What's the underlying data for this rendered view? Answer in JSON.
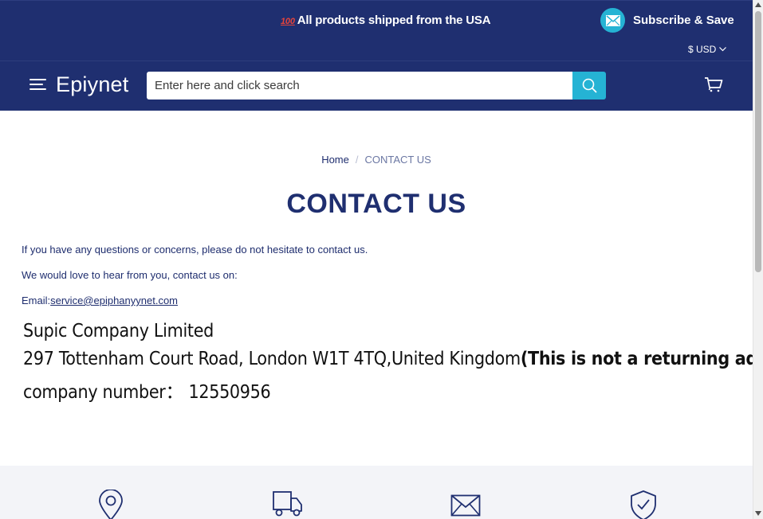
{
  "announcement": {
    "badge": "100",
    "text": "All products shipped from the USA"
  },
  "subscribe": {
    "label": "Subscribe & Save",
    "icon": "mail-icon"
  },
  "currency": {
    "label": "$ USD"
  },
  "header": {
    "brand": "Epiynet",
    "search": {
      "placeholder": "Enter here and click search",
      "value": ""
    }
  },
  "breadcrumb": {
    "home": "Home",
    "separator": "/",
    "current": "CONTACT US"
  },
  "page": {
    "title": "CONTACT US",
    "intro": "If you have any questions or concerns, please do not hesitate to contact us.",
    "love": "We would love to hear from you, contact us on:",
    "email_label": "Email:",
    "email": "service@epiphanyynet.com"
  },
  "address_image": {
    "line1": "Supic Company Limited",
    "line2": "297 Tottenham Court Road, London W1T 4TQ,United Kingdom",
    "line2_bold": "(This is not a returning address)",
    "line3": "company number： 12550956"
  },
  "features": [
    "location-pin-icon",
    "delivery-truck-icon",
    "envelope-icon",
    "shield-check-icon"
  ],
  "colors": {
    "navy": "#1f2f70",
    "accent": "#25b3d4",
    "features_bg": "#f3f4f8"
  }
}
